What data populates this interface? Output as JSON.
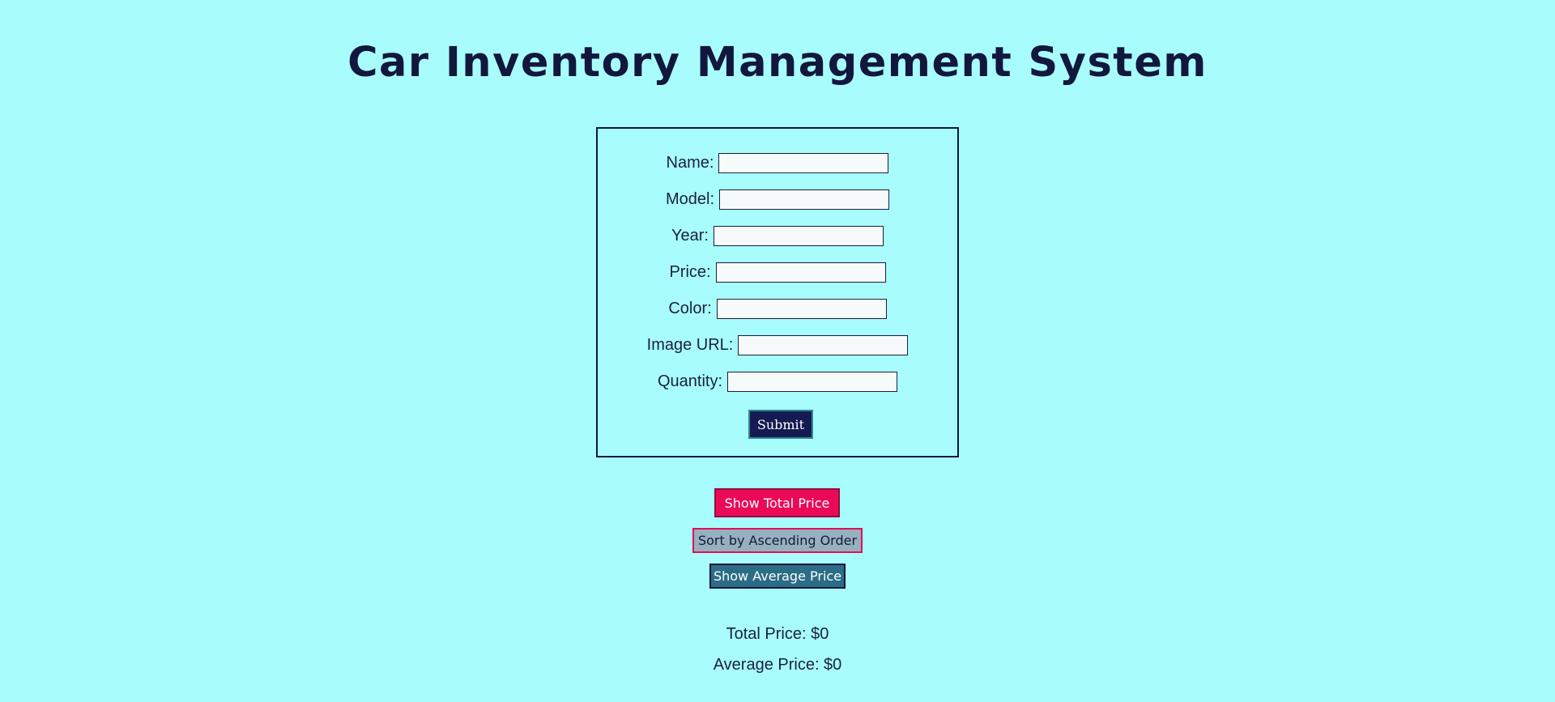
{
  "header": {
    "title": "Car Inventory Management System"
  },
  "form": {
    "fields": [
      {
        "label": "Name:",
        "value": "",
        "placeholder": ""
      },
      {
        "label": "Model:",
        "value": "",
        "placeholder": ""
      },
      {
        "label": "Year:",
        "value": "",
        "placeholder": ""
      },
      {
        "label": "Price:",
        "value": "",
        "placeholder": ""
      },
      {
        "label": "Color:",
        "value": "",
        "placeholder": ""
      },
      {
        "label": "Image URL:",
        "value": "",
        "placeholder": ""
      },
      {
        "label": "Quantity:",
        "value": "",
        "placeholder": ""
      }
    ],
    "submit_label": "Submit"
  },
  "actions": {
    "total_label": "Show Total Price",
    "sort_label": "Sort by Ascending Order",
    "average_label": "Show Average Price"
  },
  "results": {
    "total_text": "Total Price: $0",
    "average_text": "Average Price: $0"
  },
  "colors": {
    "background": "#a8fdfc",
    "title": "#12173d",
    "submit_bg": "#161a52",
    "total_button_bg": "#ea0a57",
    "sort_button_bg": "#97b0be",
    "average_button_bg": "#2b6d86"
  }
}
